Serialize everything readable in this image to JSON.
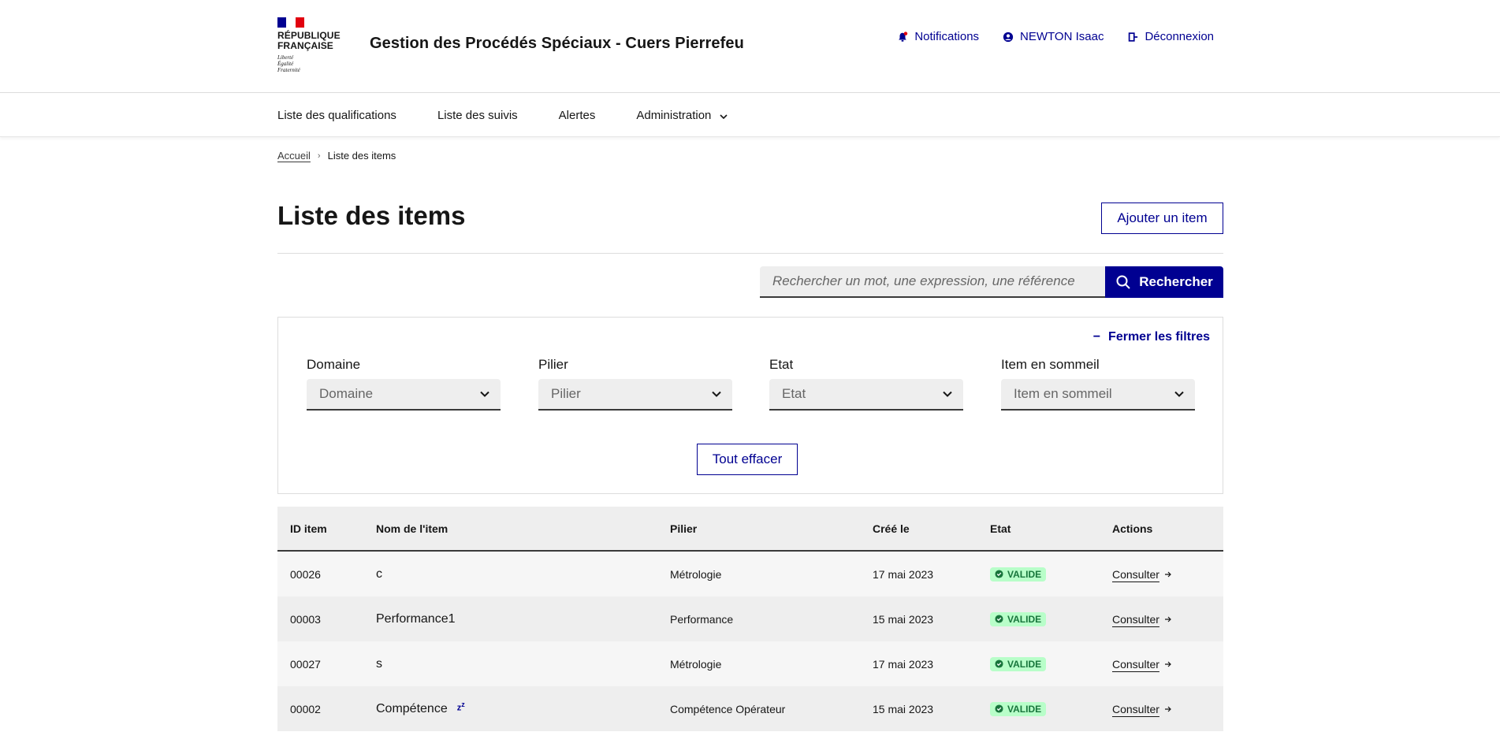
{
  "header": {
    "logo_line1": "RÉPUBLIQUE",
    "logo_line2": "FRANÇAISE",
    "motto": [
      "Liberté",
      "Égalité",
      "Fraternité"
    ],
    "service_title": "Gestion des Procédés Spéciaux - Cuers Pierrefeu",
    "tools": {
      "notifications": "Notifications",
      "user": "NEWTON Isaac",
      "logout": "Déconnexion"
    }
  },
  "nav": {
    "items": [
      {
        "label": "Liste des qualifications"
      },
      {
        "label": "Liste des suivis"
      },
      {
        "label": "Alertes"
      },
      {
        "label": "Administration"
      }
    ]
  },
  "breadcrumb": {
    "home": "Accueil",
    "current": "Liste des items"
  },
  "page": {
    "title": "Liste des items",
    "add_button": "Ajouter un item"
  },
  "search": {
    "placeholder": "Rechercher un mot, une expression, une référence",
    "button": "Rechercher"
  },
  "filters": {
    "close_label": "Fermer les filtres",
    "groups": [
      {
        "label": "Domaine",
        "value": "Domaine"
      },
      {
        "label": "Pilier",
        "value": "Pilier"
      },
      {
        "label": "Etat",
        "value": "Etat"
      },
      {
        "label": "Item en sommeil",
        "value": "Item en sommeil"
      }
    ],
    "clear_button": "Tout effacer"
  },
  "table": {
    "headers": {
      "id": "ID item",
      "name": "Nom de l'item",
      "pilier": "Pilier",
      "cree": "Créé le",
      "etat": "Etat",
      "actions": "Actions"
    },
    "rows": [
      {
        "id": "00026",
        "name": "c",
        "pilier": "Métrologie",
        "cree": "17 mai 2023",
        "etat": "VALIDE",
        "action": "Consulter",
        "sleeping": false
      },
      {
        "id": "00003",
        "name": "Performance1",
        "pilier": "Performance",
        "cree": "15 mai 2023",
        "etat": "VALIDE",
        "action": "Consulter",
        "sleeping": false
      },
      {
        "id": "00027",
        "name": "s",
        "pilier": "Métrologie",
        "cree": "17 mai 2023",
        "etat": "VALIDE",
        "action": "Consulter",
        "sleeping": false
      },
      {
        "id": "00002",
        "name": "Compétence",
        "pilier": "Compétence Opérateur",
        "cree": "15 mai 2023",
        "etat": "VALIDE",
        "action": "Consulter",
        "sleeping": true
      }
    ]
  },
  "colors": {
    "primary": "#000091",
    "success_bg": "#b8fec9",
    "success_text": "#18753c",
    "flag_blue": "#000091",
    "flag_red": "#e1000f"
  },
  "icons": {
    "notifications": "bell-icon",
    "user": "user-icon",
    "logout": "logout-icon",
    "search": "search-icon",
    "chevron": "chevron-down-icon",
    "check": "check-circle-icon",
    "arrow": "arrow-right-icon",
    "sleep": "sleep-icon"
  }
}
